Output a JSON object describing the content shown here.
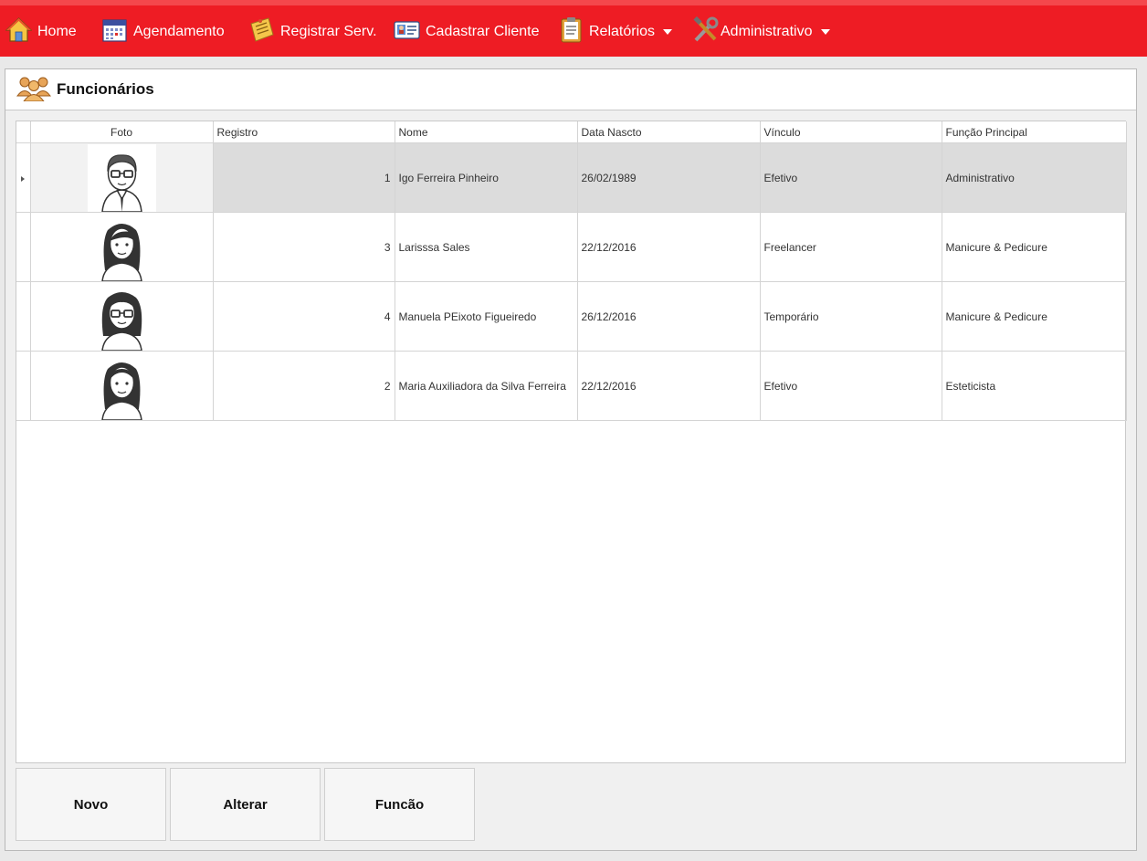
{
  "nav": {
    "home": "Home",
    "agendamento": "Agendamento",
    "registrar": "Registrar Serv.",
    "cadastrar": "Cadastrar Cliente",
    "relatorios": "Relatórios",
    "administrativo": "Administrativo"
  },
  "page": {
    "title": "Funcionários"
  },
  "table": {
    "columns": [
      "Foto",
      "Registro",
      "Nome",
      "Data Nascto",
      "Vínculo",
      "Função Principal"
    ],
    "rows": [
      {
        "registro": "1",
        "nome": "Igo Ferreira Pinheiro",
        "data": "26/02/1989",
        "vinculo": "Efetivo",
        "funcao": "Administrativo",
        "avatar": "man-glasses-avatar"
      },
      {
        "registro": "3",
        "nome": "Larisssa Sales",
        "data": "22/12/2016",
        "vinculo": "Freelancer",
        "funcao": "Manicure & Pedicure",
        "avatar": "woman-avatar"
      },
      {
        "registro": "4",
        "nome": "Manuela PEixoto Figueiredo",
        "data": "26/12/2016",
        "vinculo": "Temporário",
        "funcao": "Manicure & Pedicure",
        "avatar": "woman-glasses-avatar"
      },
      {
        "registro": "2",
        "nome": "Maria Auxiliadora da Silva Ferreira",
        "data": "22/12/2016",
        "vinculo": "Efetivo",
        "funcao": "Esteticista",
        "avatar": "woman-avatar"
      }
    ]
  },
  "buttons": {
    "novo": "Novo",
    "alterar": "Alterar",
    "funcao": "Funcão"
  },
  "colors": {
    "topbar": "#ee1c24",
    "selected_row": "#dcdcdc"
  }
}
